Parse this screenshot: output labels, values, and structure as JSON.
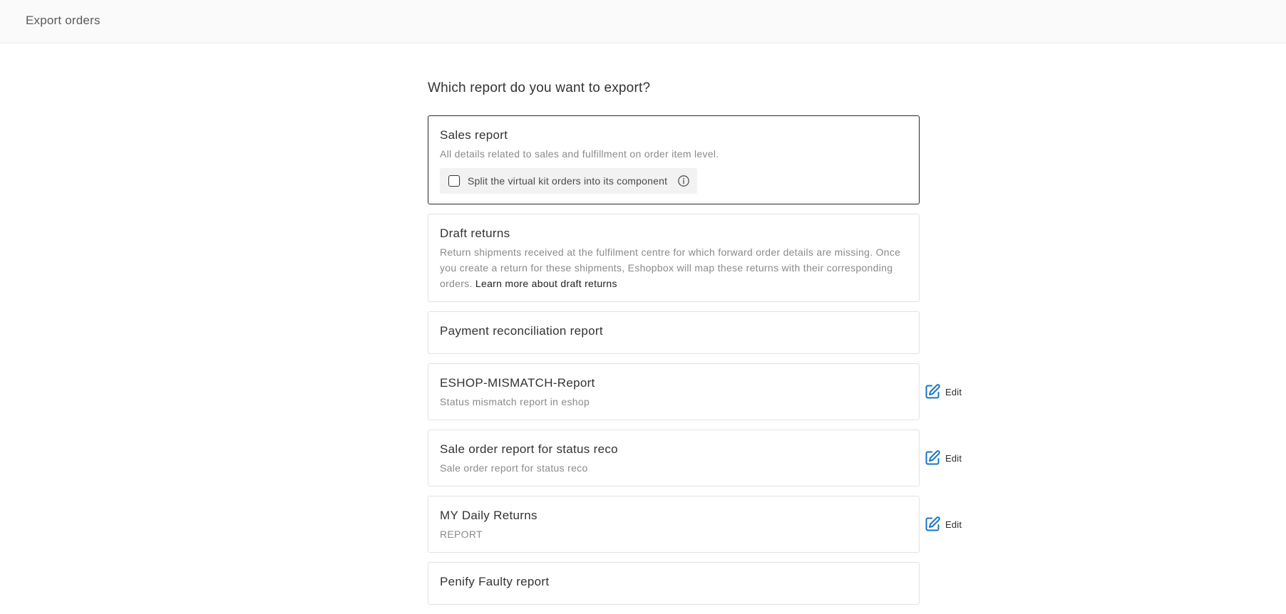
{
  "header": {
    "title": "Export orders"
  },
  "main": {
    "question": "Which report do you want to export?",
    "reports": [
      {
        "title": "Sales report",
        "description": "All details related to sales and fulfillment on order item level.",
        "option_label": "Split the virtual kit orders into its component"
      },
      {
        "title": "Draft returns",
        "description": "Return shipments received at the fulfilment centre for which forward order details are missing. Once you create a return for these shipments, Eshopbox will map these returns with their corresponding orders.",
        "link_text": "Learn more about draft returns"
      },
      {
        "title": "Payment reconciliation report"
      },
      {
        "title": "ESHOP-MISMATCH-Report",
        "description": "Status mismatch report in eshop",
        "edit_label": "Edit"
      },
      {
        "title": "Sale order report for status reco",
        "description": "Sale order report for status reco",
        "edit_label": "Edit"
      },
      {
        "title": "MY Daily Returns",
        "description": "REPORT",
        "edit_label": "Edit"
      },
      {
        "title": "Penify Faulty report"
      }
    ]
  },
  "colors": {
    "edit_icon": "#1a73c8",
    "selected_border": "#2a2a2a",
    "card_border": "#e2e2e2"
  },
  "icons": {
    "info": "info-circle-icon",
    "edit": "edit-pencil-icon"
  }
}
